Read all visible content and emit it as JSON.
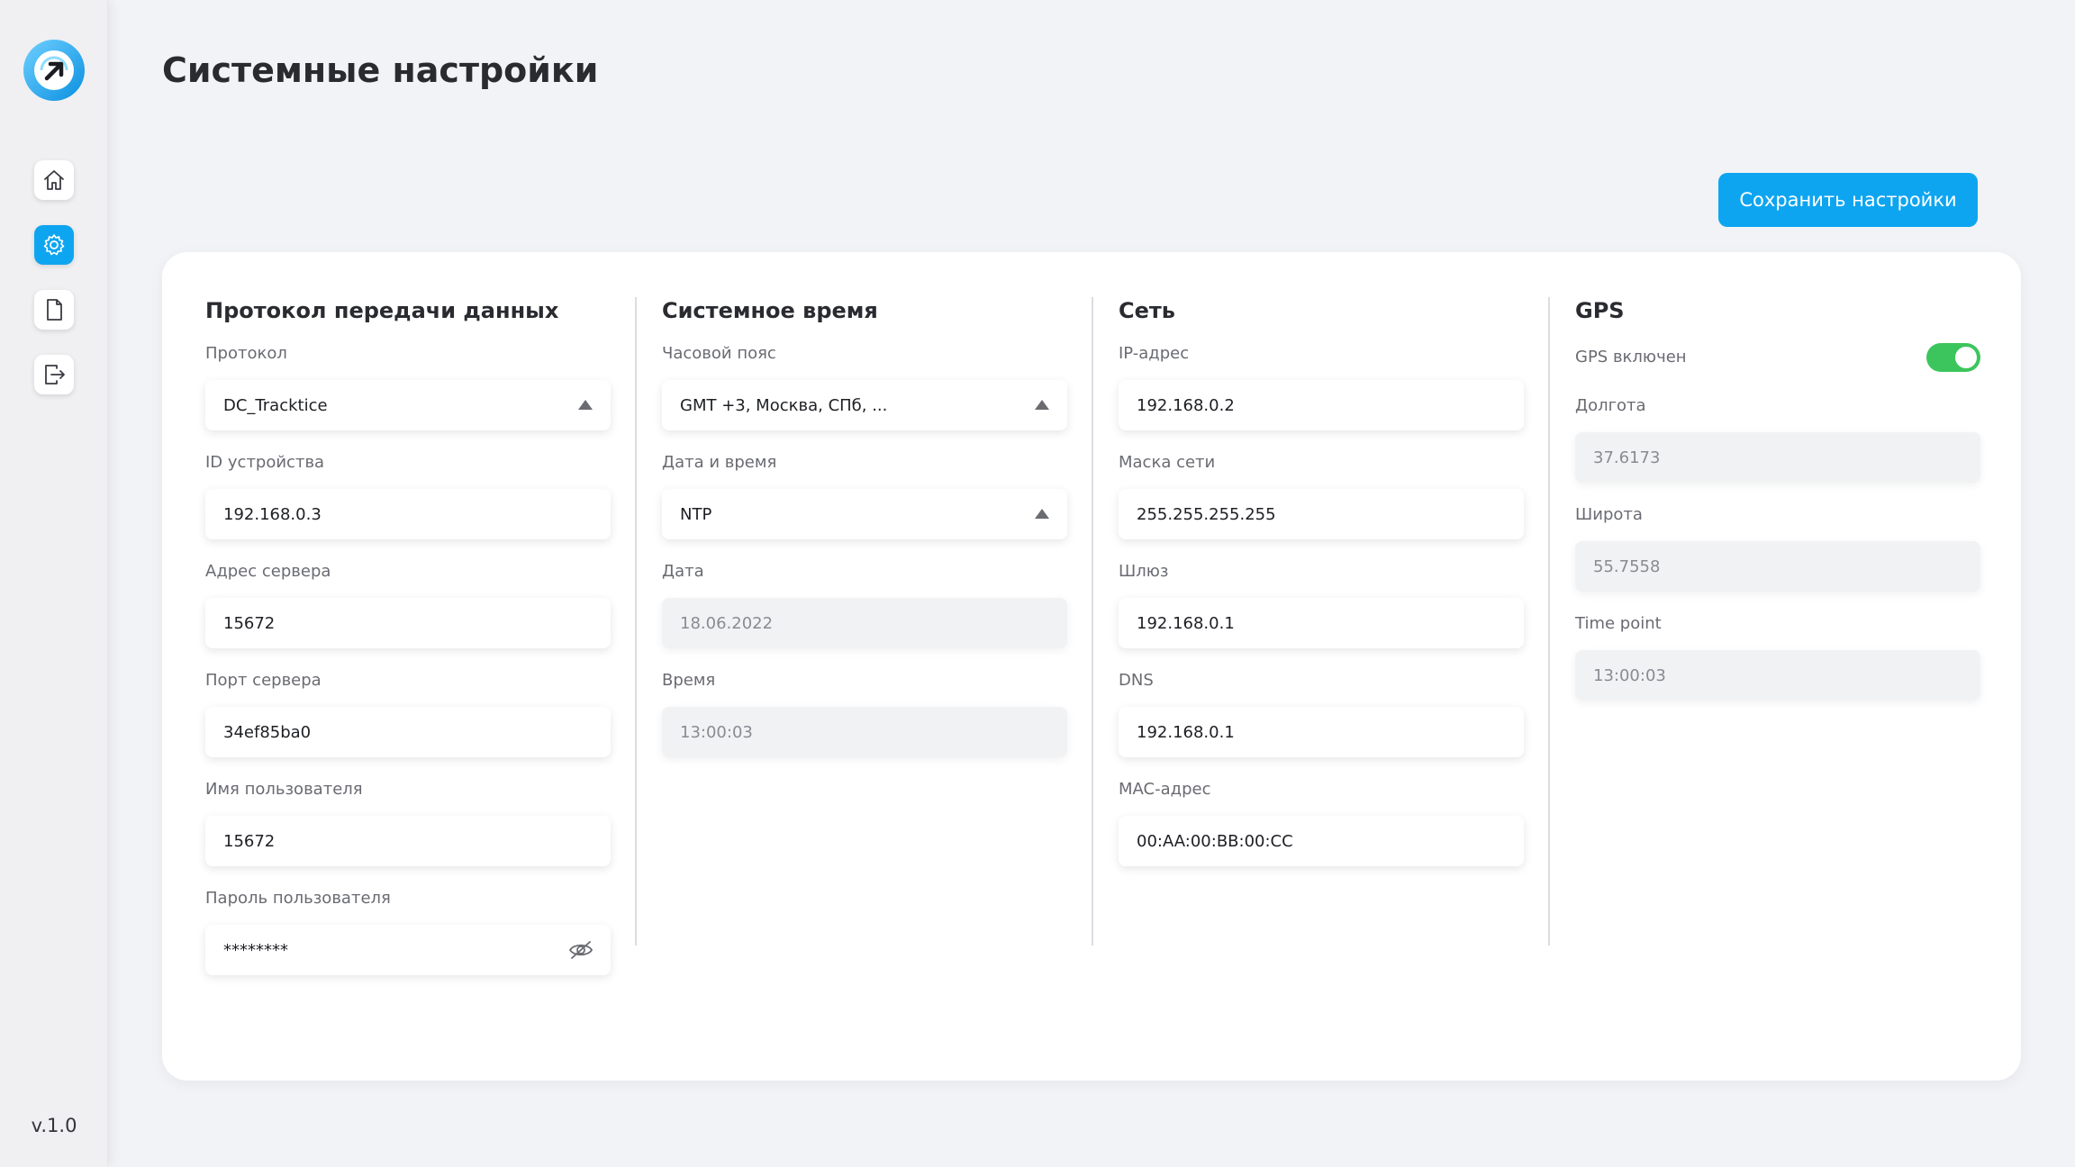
{
  "page": {
    "title": "Системные настройки",
    "version": "v.1.0"
  },
  "actions": {
    "save_label": "Сохранить настройки"
  },
  "sidebar": {
    "items": [
      {
        "icon": "home-icon"
      },
      {
        "icon": "gear-icon",
        "active": true
      },
      {
        "icon": "document-icon"
      },
      {
        "icon": "logout-icon"
      }
    ]
  },
  "colors": {
    "accent": "#0ea5f0",
    "toggle_on": "#3cc55c"
  },
  "protocol": {
    "title": "Протокол передачи данных",
    "protocol": {
      "label": "Протокол",
      "value": "DC_Tracktice"
    },
    "device_id": {
      "label": "ID устройства",
      "value": "192.168.0.3"
    },
    "server_address": {
      "label": "Адрес сервера",
      "value": "15672"
    },
    "server_port": {
      "label": "Порт сервера",
      "value": "34ef85ba0"
    },
    "username": {
      "label": "Имя пользователя",
      "value": "15672"
    },
    "password": {
      "label": "Пароль пользователя",
      "value": "********"
    }
  },
  "system_time": {
    "title": "Системное время",
    "timezone": {
      "label": "Часовой пояс",
      "value": "GMT +3, Москва, СПб, ..."
    },
    "datetime": {
      "label": "Дата и время",
      "value": "NTP"
    },
    "date": {
      "label": "Дата",
      "value": "18.06.2022"
    },
    "time": {
      "label": "Время",
      "value": "13:00:03"
    }
  },
  "network": {
    "title": "Сеть",
    "ip": {
      "label": "IP-адрес",
      "value": "192.168.0.2"
    },
    "mask": {
      "label": "Маска сети",
      "value": "255.255.255.255"
    },
    "gateway": {
      "label": "Шлюз",
      "value": "192.168.0.1"
    },
    "dns": {
      "label": "DNS",
      "value": "192.168.0.1"
    },
    "mac": {
      "label": "MAC-адрес",
      "value": "00:AA:00:BB:00:CC"
    }
  },
  "gps": {
    "title": "GPS",
    "enabled": {
      "label": "GPS включен",
      "on": true
    },
    "longitude": {
      "label": "Долгота",
      "value": "37.6173"
    },
    "latitude": {
      "label": "Широта",
      "value": "55.7558"
    },
    "time_point": {
      "label": "Time point",
      "value": "13:00:03"
    }
  }
}
